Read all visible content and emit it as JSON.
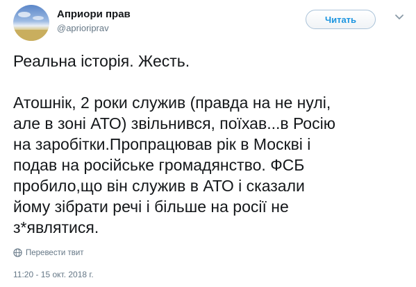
{
  "author": {
    "name": "Априори прав",
    "handle": "@aprioriprav"
  },
  "follow_button_label": "Читать",
  "menu_icon": "chevron-down-icon",
  "tweet": {
    "text": "Реальна історія. Жесть.\n\nАтошнік, 2 роки служив (правда на не нулі,\nале в зоні АТО) звільнився, поїхав...в Росію\nна заробітки.Пропрацював рік в Москві і\nподав на російське громадянство. ФСБ\nпробило,що він служив в АТО і сказали\nйому зібрати речі і більше на росії не\nз*являтися."
  },
  "translate_label": "Перевести твит",
  "timestamp": "11:20 - 15 окт. 2018 г.",
  "colors": {
    "link_blue": "#1b95e0",
    "muted_gray": "#657786"
  }
}
